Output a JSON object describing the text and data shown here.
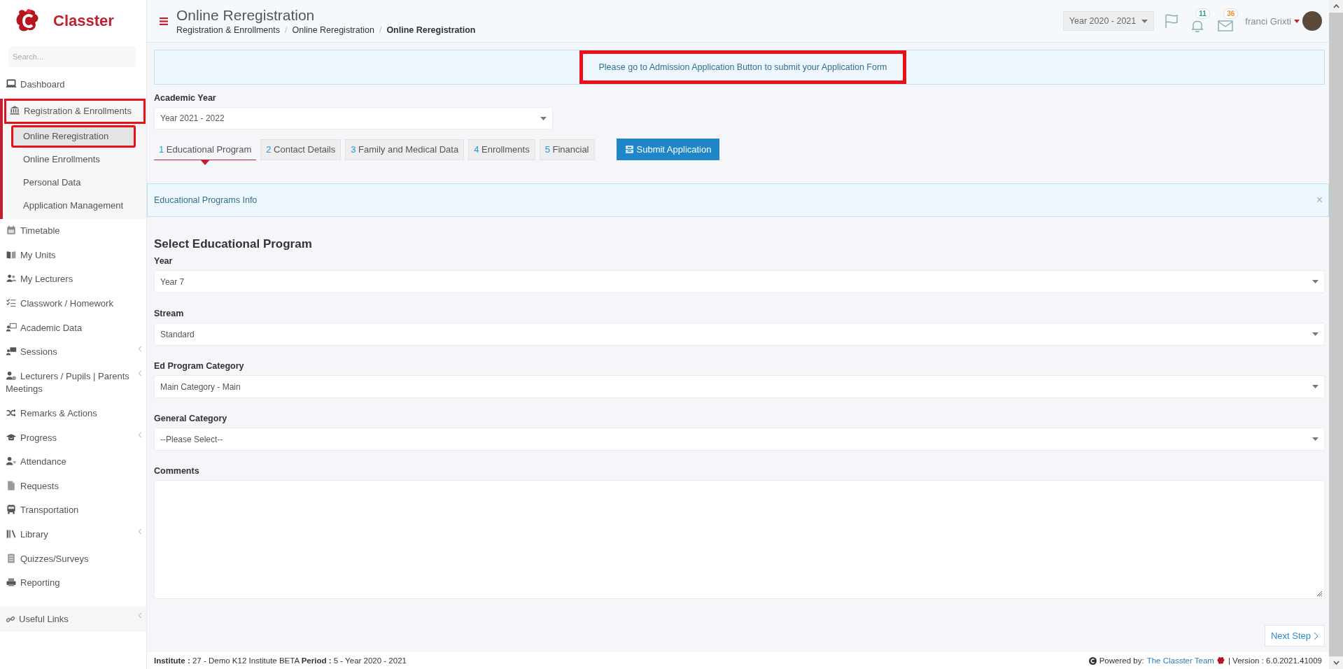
{
  "sidebar": {
    "logo_text": "Classter",
    "search": {
      "placeholder": "Search..."
    },
    "items": [
      {
        "label": "Dashboard",
        "expandable": false
      },
      {
        "label": "Registration & Enrollments",
        "expandable": false,
        "expanded": true,
        "highlighted": true,
        "children": [
          {
            "label": "Online Reregistration",
            "selected": true,
            "highlighted": true
          },
          {
            "label": "Online Enrollments",
            "selected": false,
            "highlighted": false
          },
          {
            "label": "Personal Data",
            "selected": false,
            "highlighted": false
          },
          {
            "label": "Application Management",
            "selected": false,
            "highlighted": false
          }
        ]
      },
      {
        "label": "Timetable",
        "expandable": false
      },
      {
        "label": "My Units",
        "expandable": false
      },
      {
        "label": "My Lecturers",
        "expandable": false
      },
      {
        "label": "Classwork / Homework",
        "expandable": false
      },
      {
        "label": "Academic Data",
        "expandable": false
      },
      {
        "label": "Sessions",
        "expandable": true
      },
      {
        "label": "Lecturers / Pupils | Parents Meetings",
        "expandable": true
      },
      {
        "label": "Remarks & Actions",
        "expandable": false
      },
      {
        "label": "Progress",
        "expandable": true
      },
      {
        "label": "Attendance",
        "expandable": false
      },
      {
        "label": "Requests",
        "expandable": false
      },
      {
        "label": "Transportation",
        "expandable": false
      },
      {
        "label": "Library",
        "expandable": true
      },
      {
        "label": "Quizzes/Surveys",
        "expandable": false
      },
      {
        "label": "Reporting",
        "expandable": false
      }
    ],
    "bottom_items": [
      {
        "label": "Useful Links",
        "expandable": true
      }
    ]
  },
  "header": {
    "title": "Online Reregistration",
    "breadcrumbs": [
      {
        "label": "Registration & Enrollments",
        "current": false,
        "separator": "/"
      },
      {
        "label": "Online Reregistration",
        "current": false,
        "separator": "/"
      },
      {
        "label": "Online Reregistration",
        "current": true
      }
    ],
    "year_selector": "Year 2020 - 2021",
    "notifications_count": "11",
    "messages_count": "36",
    "user_name": "franci Grixti"
  },
  "notice": {
    "text": "Please go to Admission Application Button to submit your Application Form",
    "highlighted": true
  },
  "academic_year": {
    "label": "Academic Year",
    "value": "Year 2021 - 2022"
  },
  "steps": [
    {
      "number": "1",
      "label": "Educational Program",
      "selected": true
    },
    {
      "number": "2",
      "label": "Contact Details",
      "selected": false
    },
    {
      "number": "3",
      "label": "Family and Medical Data",
      "selected": false
    },
    {
      "number": "4",
      "label": "Enrollments",
      "selected": false
    },
    {
      "number": "5",
      "label": "Financial",
      "selected": false
    }
  ],
  "submit_button": "Submit Application",
  "info_panel": {
    "title": "Educational Programs Info",
    "close": "×"
  },
  "form": {
    "title": "Select Educational Program",
    "fields": [
      {
        "kind": "select",
        "label": "Year",
        "value": "Year 7"
      },
      {
        "kind": "select",
        "label": "Stream",
        "value": "Standard"
      },
      {
        "kind": "select",
        "label": "Ed Program Category",
        "value": "Main Category - Main"
      },
      {
        "kind": "select",
        "label": "General Category",
        "value": "--Please Select--"
      },
      {
        "kind": "textarea",
        "label": "Comments"
      }
    ]
  },
  "next_button": "Next Step",
  "footer": {
    "info": "**Institute :** 27 - Demo K12 Institute BETA **Period :** 5 - Year 2020 - 2021",
    "powered_by": "Powered by:",
    "team_link": "The Classter Team",
    "version": "| Version : 6.0.2021.41009"
  }
}
